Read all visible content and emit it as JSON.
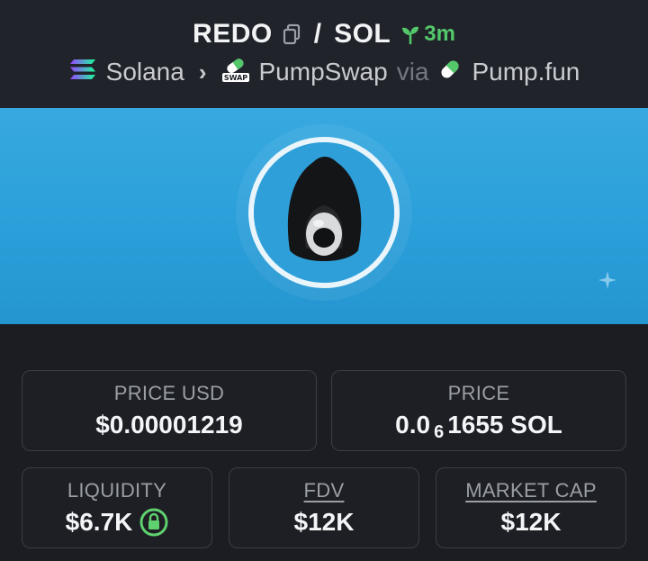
{
  "header": {
    "base_token": "REDO",
    "separator": "/",
    "quote_token": "SOL",
    "age": "3m",
    "chain": "Solana",
    "dex": "PumpSwap",
    "dex_badge": "SWAP",
    "via_label": "via",
    "launchpad": "Pump.fun"
  },
  "icons": {
    "copy": "copy-icon",
    "sprout": "sprout-icon",
    "chain": "solana-logo-icon",
    "dex": "pumpswap-logo-icon",
    "launchpad": "pill-icon",
    "liquidity_lock": "lock-icon"
  },
  "colors": {
    "age_green": "#53c76a",
    "banner_blue": "#2a9fd9",
    "lock_green": "#5fd16e"
  },
  "stats": {
    "price_usd": {
      "label": "PRICE USD",
      "value": "$0.00001219"
    },
    "price": {
      "label": "PRICE",
      "value_prefix": "0.0",
      "value_zeros": "6",
      "value_suffix": "1655 SOL"
    },
    "liquidity": {
      "label": "LIQUIDITY",
      "value": "$6.7K"
    },
    "fdv": {
      "label": "FDV",
      "value": "$12K"
    },
    "market_cap": {
      "label": "MARKET CAP",
      "value": "$12K"
    }
  }
}
